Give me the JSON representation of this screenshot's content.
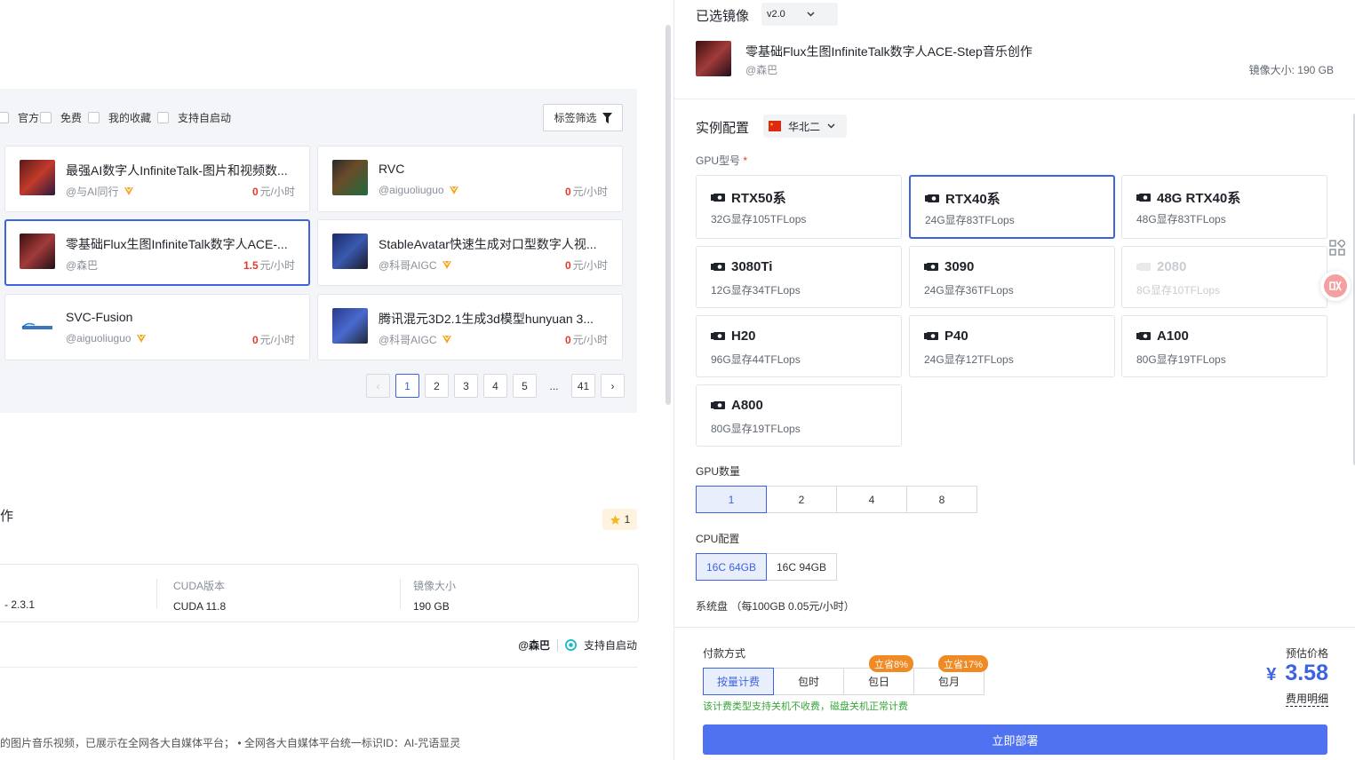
{
  "filters": [
    {
      "label": "官方"
    },
    {
      "label": "免费"
    },
    {
      "label": "我的收藏"
    },
    {
      "label": "支持自启动"
    }
  ],
  "tag_filter_label": "标签筛选",
  "cards": [
    {
      "title": "最强AI数字人InfiniteTalk-图片和视频数...",
      "author": "@与AI同行",
      "price": "0",
      "unit": "元/小时",
      "selected": false
    },
    {
      "title": "RVC",
      "author": "@aiguoliuguo",
      "price": "0",
      "unit": "元/小时",
      "selected": false
    },
    {
      "title": "零基础Flux生图InfiniteTalk数字人ACE-...",
      "author": "@森巴",
      "price": "1.5",
      "unit": "元/小时",
      "selected": true
    },
    {
      "title": "StableAvatar快速生成对口型数字人视...",
      "author": "@科哥AIGC",
      "price": "0",
      "unit": "元/小时",
      "selected": false
    },
    {
      "title": "SVC-Fusion",
      "author": "@aiguoliuguo",
      "price": "0",
      "unit": "元/小时",
      "selected": false
    },
    {
      "title": "腾讯混元3D2.1生成3d模型hunyuan 3...",
      "author": "@科哥AIGC",
      "price": "0",
      "unit": "元/小时",
      "selected": false
    }
  ],
  "pagination": {
    "prev": "‹",
    "pages": [
      "1",
      "2",
      "3",
      "4",
      "5"
    ],
    "dots": "...",
    "last": "41",
    "next": "›",
    "current": "1"
  },
  "detail": {
    "title_fragment": "作",
    "star_count": "1",
    "info": [
      {
        "label": "",
        "value": "- 2.3.1"
      },
      {
        "label": "CUDA版本",
        "value": "CUDA 11.8"
      },
      {
        "label": "镜像大小",
        "value": "190 GB"
      }
    ],
    "author": "@森巴",
    "autostart": "支持自启动",
    "desc": "的图片音乐视频，已展示在全网各大自媒体平台； • 全网各大自媒体平台统一标识ID：AI-咒语显灵"
  },
  "right": {
    "selected_image_label": "已选镜像",
    "version": "v2.0",
    "image_name": "零基础Flux生图InfiniteTalk数字人ACE-Step音乐创作",
    "image_author": "@森巴",
    "image_size": "镜像大小: 190 GB",
    "instance_config_label": "实例配置",
    "region": "华北二",
    "gpu_model_label": "GPU型号",
    "required_mark": "*",
    "gpus": [
      {
        "name": "RTX50系",
        "spec": "32G显存105TFLops",
        "state": "normal"
      },
      {
        "name": "RTX40系",
        "spec": "24G显存83TFLops",
        "state": "selected"
      },
      {
        "name": "48G RTX40系",
        "spec": "48G显存83TFLops",
        "state": "normal"
      },
      {
        "name": "3080Ti",
        "spec": "12G显存34TFLops",
        "state": "normal"
      },
      {
        "name": "3090",
        "spec": "24G显存36TFLops",
        "state": "normal"
      },
      {
        "name": "2080",
        "spec": "8G显存10TFLops",
        "state": "disabled"
      },
      {
        "name": "H20",
        "spec": "96G显存44TFLops",
        "state": "normal"
      },
      {
        "name": "P40",
        "spec": "24G显存12TFLops",
        "state": "normal"
      },
      {
        "name": "A100",
        "spec": "80G显存19TFLops",
        "state": "normal"
      },
      {
        "name": "A800",
        "spec": "80G显存19TFLops",
        "state": "normal"
      }
    ],
    "gpu_count_label": "GPU数量",
    "gpu_counts": [
      "1",
      "2",
      "4",
      "8"
    ],
    "cpu_label": "CPU配置",
    "cpu_options": [
      "16C 64GB",
      "16C 94GB"
    ],
    "disk_label": "系统盘 （每100GB 0.05元/小时）",
    "payment_label": "付款方式",
    "payment_options": [
      "按量计费",
      "包时",
      "包日",
      "包月"
    ],
    "badge_day": "立省8%",
    "badge_month": "立省17%",
    "payment_note": "该计费类型支持关机不收费，磁盘关机正常计费",
    "est_price_label": "预估价格",
    "currency": "¥",
    "price": "3.58",
    "price_detail": "费用明细",
    "deploy_label": "立即部署"
  },
  "colors": {
    "accent": "#3d63e0",
    "price_red": "#e0392b",
    "badge_orange": "#f08a24",
    "note_green": "#3aa63a"
  }
}
